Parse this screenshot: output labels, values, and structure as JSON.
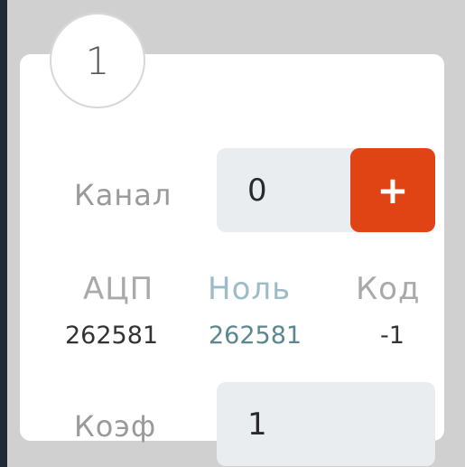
{
  "badge": {
    "number": "1"
  },
  "channel": {
    "label": "Канал",
    "value": "0",
    "add_label": "+"
  },
  "table": {
    "headers": {
      "adc": "АЦП",
      "zero": "Ноль",
      "code": "Код"
    },
    "values": {
      "adc": "262581",
      "zero": "262581",
      "code": "-1"
    }
  },
  "coef": {
    "label": "Коэф",
    "value": "1"
  },
  "colors": {
    "accent": "#e04414",
    "zero_header": "#9dbcc8",
    "zero_value": "#5a8790",
    "input_bg": "#e9edf0",
    "frame_bg": "#d0d0d0"
  }
}
